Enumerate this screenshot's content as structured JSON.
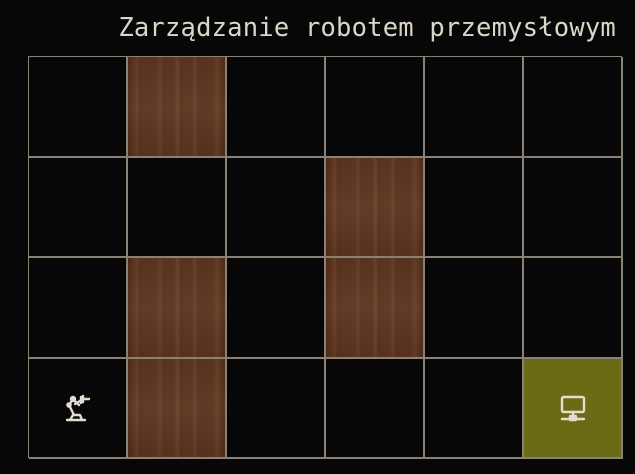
{
  "title": "Zarządzanie robotem przemysłowym",
  "grid": {
    "columns": 6,
    "rows": 4,
    "cells": [
      [
        "empty",
        "crate",
        "empty",
        "empty",
        "empty",
        "empty"
      ],
      [
        "empty",
        "empty",
        "empty",
        "crate",
        "empty",
        "empty"
      ],
      [
        "empty",
        "crate",
        "empty",
        "crate",
        "empty",
        "empty"
      ],
      [
        "robot",
        "crate",
        "empty",
        "empty",
        "empty",
        "goal"
      ]
    ]
  },
  "colors": {
    "background": "#070707",
    "grid_line": "#8a8073",
    "crate": "#5d3822",
    "goal": "#6b6b16",
    "icon": "#e3ddd0",
    "title": "#dcd6c9"
  },
  "icons": {
    "robot": "robot-arm-icon",
    "goal": "computer-terminal-icon"
  }
}
